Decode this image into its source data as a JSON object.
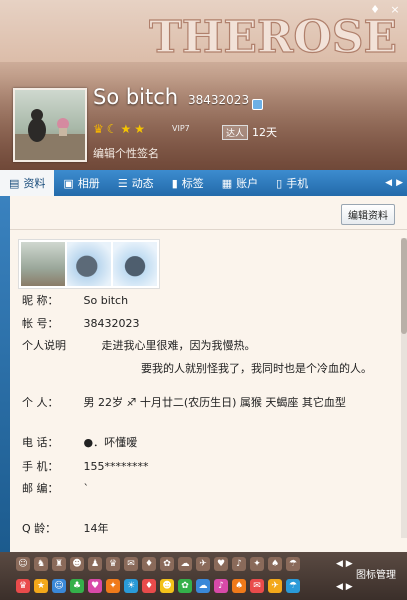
{
  "header": {
    "skin_text": "THEROSE",
    "nickname": "So bitch",
    "qq_number": "38432023",
    "vip_label": "VIP7",
    "daren_label": "达人",
    "daren_days": "12天",
    "signature_placeholder": "编辑个性签名",
    "level_icons": [
      "crown-icon",
      "moon-icon",
      "star-icon",
      "star-icon"
    ]
  },
  "tabs": [
    {
      "label": "资料",
      "icon": "profile-card-icon"
    },
    {
      "label": "相册",
      "icon": "photo-album-icon"
    },
    {
      "label": "动态",
      "icon": "feed-list-icon"
    },
    {
      "label": "标签",
      "icon": "bookmark-icon"
    },
    {
      "label": "账户",
      "icon": "wallet-icon"
    },
    {
      "label": "手机",
      "icon": "phone-icon"
    }
  ],
  "edit_button": "编辑资料",
  "profile": {
    "nickname_label": "昵    称：",
    "nickname_value": "So bitch",
    "account_label": "帐    号：",
    "account_value": "38432023",
    "desc_label": "个人说明",
    "desc_line1": "走进我心里很难，因为我慢热。",
    "desc_line2": "要我的人就别怪我了，我同时也是个冷血的人。",
    "personal_label": "个    人：",
    "personal_value": "男   22岁   ♐ 十月廿二(农历生日)   属猴   天蝎座   其它血型",
    "phone_label": "电    话：",
    "phone_value": "●．吥懂嗳",
    "mobile_label": "手    机：",
    "mobile_value": "155********",
    "email_label": "邮    编：",
    "email_value": "`",
    "qage_label": "Q    龄：",
    "qage_value": "14年"
  },
  "bottom": {
    "icon_manager": "图标管理"
  },
  "colors": {
    "tab_bar": "#2f7cc0",
    "content_bg": "#fbf4ec",
    "header_bg": "#d9b8a3"
  }
}
